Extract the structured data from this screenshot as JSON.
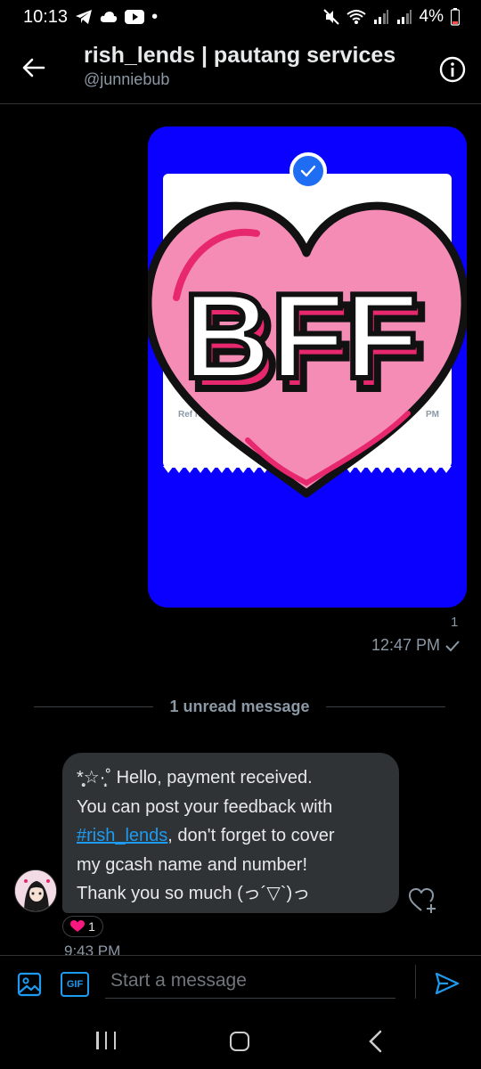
{
  "status_bar": {
    "time": "10:13",
    "dot": "•",
    "battery": "4%"
  },
  "header": {
    "title": "rish_lends | pautang services",
    "handle": "@junniebub"
  },
  "image_message": {
    "receipt_ref_label": "Ref No.",
    "receipt_time_label": "PM",
    "sticker_text": "BFF",
    "read_count": "1",
    "time": "12:47 PM"
  },
  "unread_divider": {
    "label": "1 unread message"
  },
  "received_message": {
    "line1": "*̥͙☆·̩͙˚ Hello, payment received.",
    "line2": "You can post your feedback with",
    "hashtag": "#rish_lends",
    "line3_rest": ", don't forget to cover",
    "line4": "my gcash name and number!",
    "line5": "Thank you so much (っ´▽`)っ",
    "reaction_count": "1",
    "time": "9:43 PM"
  },
  "composer": {
    "gif_label": "GIF",
    "placeholder": "Start a message"
  },
  "colors": {
    "accent": "#1d9bf0",
    "bubble_image_bg": "#0a00ff",
    "heart_pink": "#f48cb6",
    "heart_dark_pink": "#e7286e",
    "received_bubble": "#2f3336",
    "muted_text": "#8b98a5"
  },
  "icons": {
    "back": "arrow-left-icon",
    "info": "info-icon",
    "verified": "check-circle-icon",
    "read": "checkmark-icon",
    "react": "heart-add-icon",
    "media": "image-icon",
    "send": "send-icon"
  }
}
